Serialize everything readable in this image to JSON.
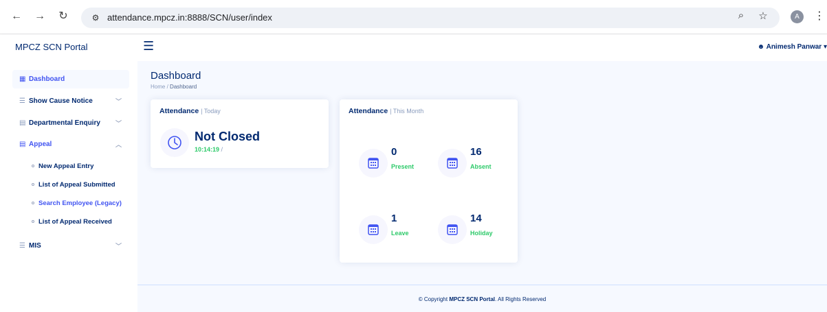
{
  "browser": {
    "url": "attendance.mpcz.in:8888/SCN/user/index",
    "profile_initial": "A"
  },
  "header": {
    "brand": "MPCZ SCN Portal",
    "user_name": "Animesh Panwar"
  },
  "sidebar": {
    "items": [
      {
        "label": "Dashboard"
      },
      {
        "label": "Show Cause Notice"
      },
      {
        "label": "Departmental Enquiry"
      },
      {
        "label": "Appeal"
      },
      {
        "label": "MIS"
      }
    ],
    "appeal_sub": [
      {
        "label": "New Appeal Entry"
      },
      {
        "label": "List of Appeal Submitted"
      },
      {
        "label": "Search Employee (Legacy)"
      },
      {
        "label": "List of Appeal Received"
      }
    ]
  },
  "page": {
    "title": "Dashboard",
    "breadcrumb_home": "Home",
    "breadcrumb_sep": "/",
    "breadcrumb_current": "Dashboard"
  },
  "today_card": {
    "title": "Attendance",
    "period": "| Today",
    "status": "Not Closed",
    "time": "10:14:19",
    "separator": "/"
  },
  "month_card": {
    "title": "Attendance",
    "period": "| This Month",
    "stats": [
      {
        "value": "0",
        "label": "Present"
      },
      {
        "value": "16",
        "label": "Absent"
      },
      {
        "value": "1",
        "label": "Leave"
      },
      {
        "value": "14",
        "label": "Holiday"
      }
    ]
  },
  "footer": {
    "prefix": "© Copyright",
    "brand": "MPCZ SCN Portal",
    "suffix": ". All Rights Reserved"
  },
  "colors": {
    "primary": "#4154f1",
    "navy": "#012970",
    "success": "#2eca6a",
    "background": "#f6f9ff"
  }
}
